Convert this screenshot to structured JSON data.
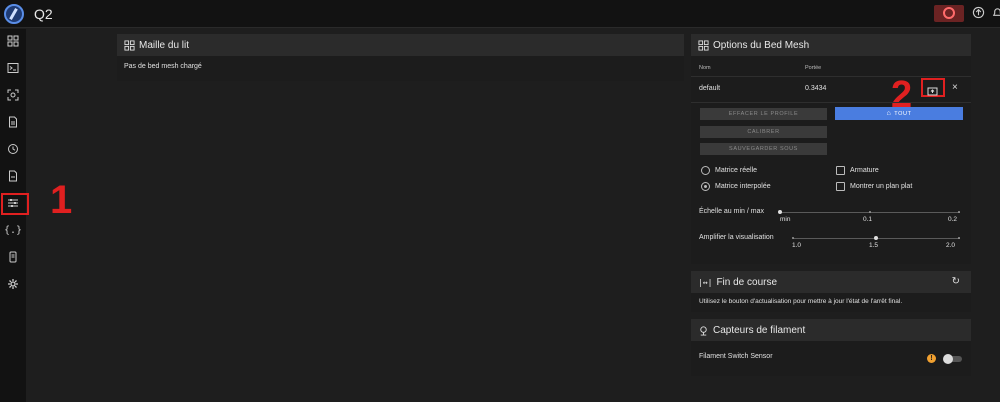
{
  "app": {
    "title": "Q2"
  },
  "sidebar": {
    "items": [
      {
        "name": "dashboard",
        "icon": "grid-icon"
      },
      {
        "name": "console",
        "icon": "terminal-icon"
      },
      {
        "name": "webcam",
        "icon": "camera-scan-icon"
      },
      {
        "name": "files",
        "icon": "file-icon"
      },
      {
        "name": "history",
        "icon": "history-icon"
      },
      {
        "name": "jobs",
        "icon": "document-icon"
      },
      {
        "name": "tune",
        "icon": "sliders-icon"
      },
      {
        "name": "config",
        "icon": "braces-icon"
      },
      {
        "name": "system",
        "icon": "device-icon"
      },
      {
        "name": "settings",
        "icon": "gear-icon"
      }
    ]
  },
  "annotations": {
    "one": "1",
    "two": "2"
  },
  "bed_card": {
    "title": "Maille du lit",
    "message": "Pas de bed mesh chargé"
  },
  "options_card": {
    "title": "Options du Bed Mesh",
    "col_name": "Nom",
    "col_range": "Portée",
    "profile_name": "default",
    "profile_range": "0.3434",
    "btn_clear": "EFFACER LE PROFILE",
    "btn_calibrate": "CALIBRER",
    "btn_save": "SAUVEGARDER SOUS",
    "btn_home": "TOUT",
    "opt_real": "Matrice réelle",
    "opt_interp": "Matrice interpolée",
    "opt_wireframe": "Armature",
    "opt_flat": "Montrer un plan plat",
    "scale_label": "Échelle au min / max",
    "scale_ticks": [
      "min",
      "0.1",
      "0.2"
    ],
    "amp_label": "Amplifier la visualisation",
    "amp_ticks": [
      "1.0",
      "1.5",
      "2.0"
    ],
    "selected_view": "Matrice interpolée"
  },
  "endstop_card": {
    "title": "Fin de course",
    "message": "Utilisez le bouton d'actualisation pour mettre à jour l'état de l'arrêt final."
  },
  "filament_card": {
    "title": "Capteurs de filament",
    "sensor_name": "Filament Switch Sensor",
    "sensor_enabled": false
  },
  "colors": {
    "accent": "#4a7de0",
    "annotation": "#e02020",
    "warning": "#f0a030",
    "alert_bg": "#6b2323"
  }
}
